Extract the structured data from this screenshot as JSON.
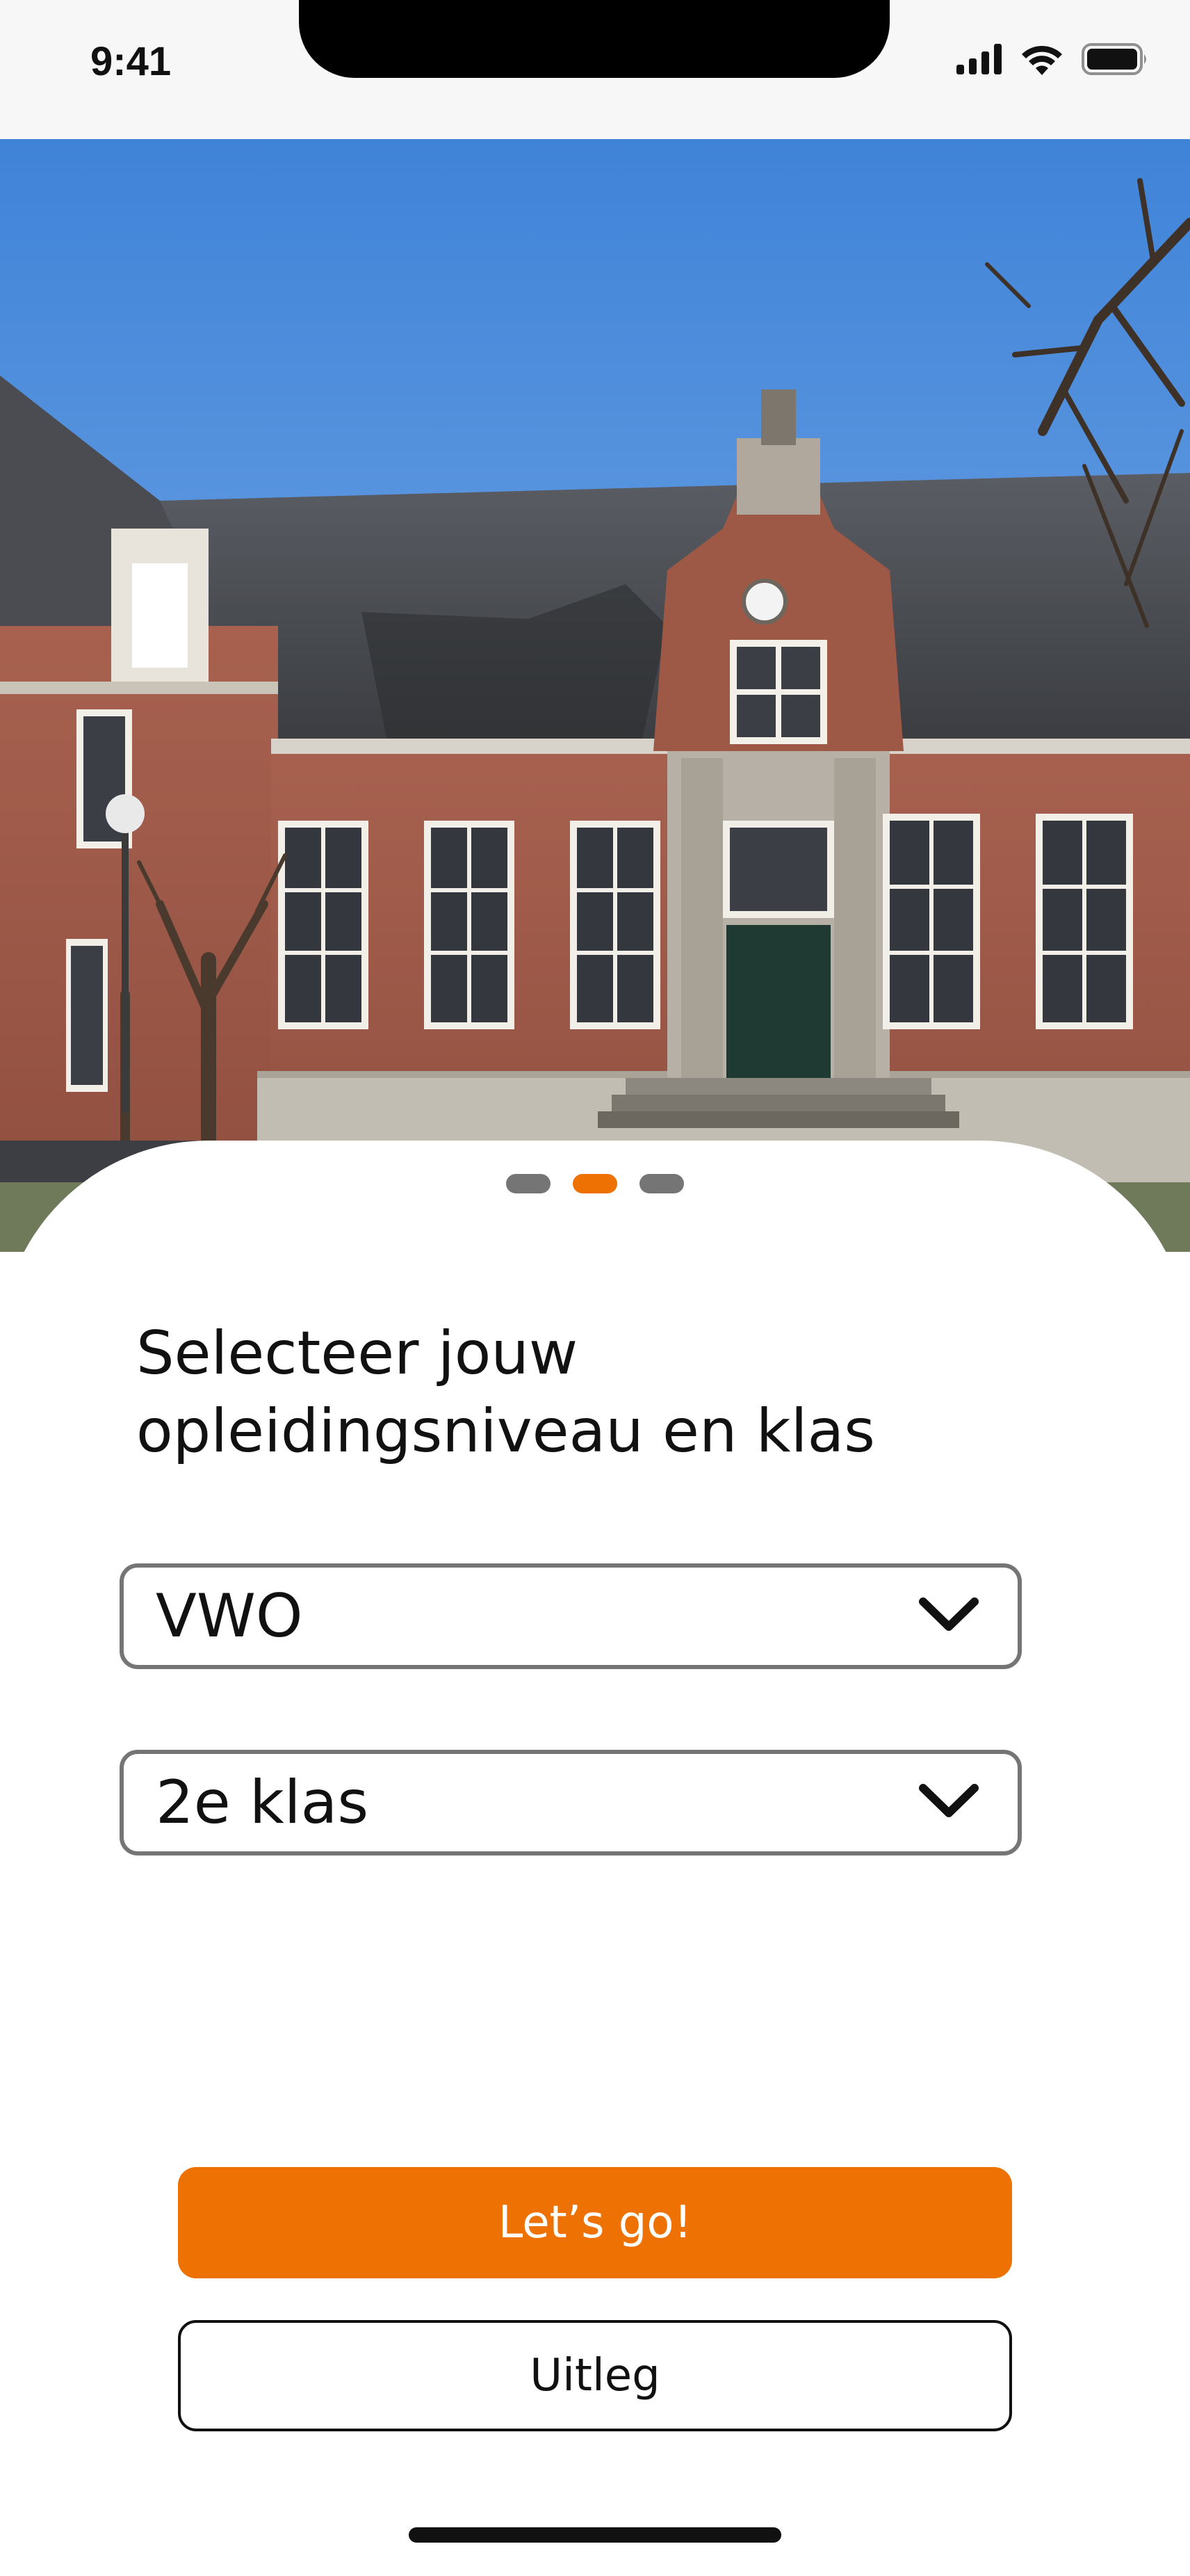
{
  "status_bar": {
    "time": "9:41",
    "icons": [
      "cellular-signal-icon",
      "wifi-icon",
      "battery-icon"
    ]
  },
  "hero": {
    "image": "school-building-photo"
  },
  "pager": {
    "count": 3,
    "active_index": 1
  },
  "heading": {
    "line1": "Selecteer jouw",
    "line2": "opleidingsniveau en klas"
  },
  "level_select": {
    "value": "VWO",
    "icon": "chevron-down-icon"
  },
  "class_select": {
    "value": "2e klas",
    "icon": "chevron-down-icon"
  },
  "buttons": {
    "primary_label": "Let’s go!",
    "secondary_label": "Uitleg"
  },
  "colors": {
    "accent": "#ee7203",
    "border": "#757575",
    "text": "#111111"
  }
}
